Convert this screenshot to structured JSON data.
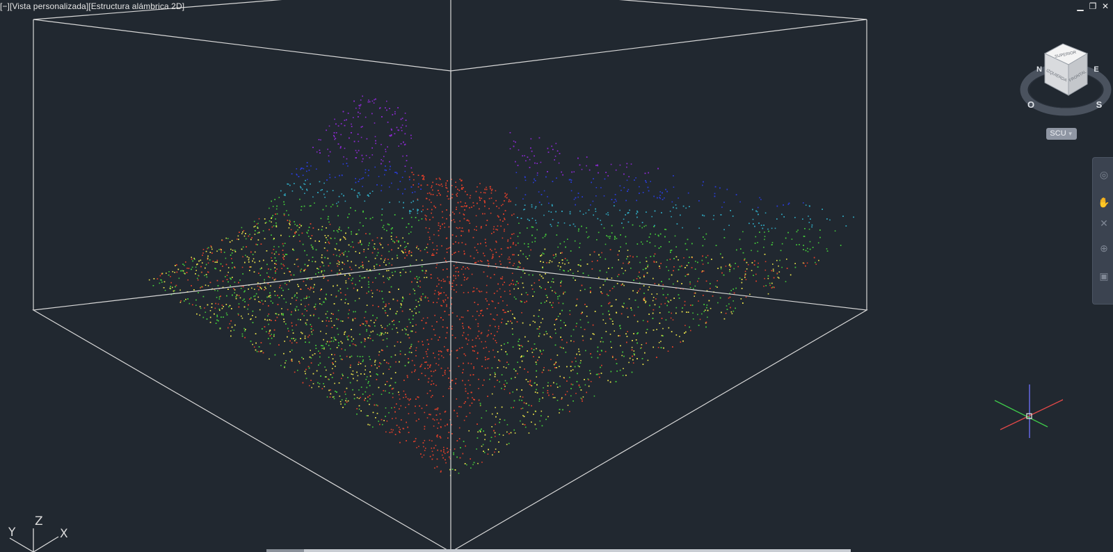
{
  "viewport": {
    "label": "[−][Vista personalizada][Estructura alámbrica 2D]"
  },
  "window_controls": {
    "minimize": "▁",
    "restore": "❐",
    "close": "✕"
  },
  "viewcube": {
    "top_face": "SUPERIOR",
    "left_face": "IZQUIERDA",
    "front_face": "FRONTAL",
    "compass": {
      "n": "N",
      "e": "E",
      "s": "S",
      "o": "O"
    }
  },
  "ucs_menu": {
    "label": "SCU"
  },
  "ucs_icon": {
    "x": "X",
    "y": "Y",
    "z": "Z"
  },
  "colors": {
    "background": "#212830",
    "wireframe": "#d8d8d8",
    "elevation_low": "#e0402a",
    "elevation_mid_low": "#e8e04a",
    "elevation_mid": "#44c83a",
    "elevation_mid_high": "#30a8c0",
    "elevation_high": "#2a3cd8",
    "elevation_top": "#8a2ad0"
  }
}
